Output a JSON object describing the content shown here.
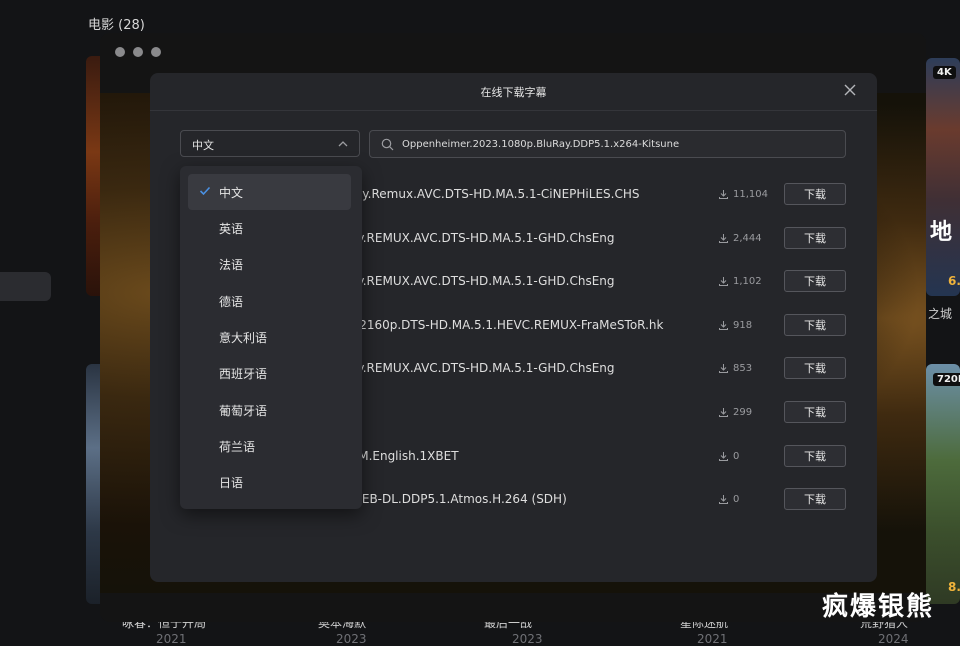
{
  "background": {
    "section_title": "电影 (28)",
    "badges": [
      "4K",
      "720P"
    ],
    "poster_text": "地",
    "ratings": [
      "6.",
      "8."
    ],
    "captions": [
      {
        "title": "咏春：恒于开局",
        "year": "2021"
      },
      {
        "title": "奥本海默",
        "year": "2023"
      },
      {
        "title": "最后一战",
        "year": "2023"
      },
      {
        "title": "星际迷航",
        "year": "2021"
      },
      {
        "title": "荒野猎人",
        "year": "2024"
      }
    ],
    "right_caption": "之城",
    "watermark": "疯爆银熊"
  },
  "modal": {
    "title": "在线下载字幕",
    "language_select": {
      "value": "中文"
    },
    "search": {
      "value": "Oppenheimer.2023.1080p.BluRay.DDP5.1.x264-Kitsune"
    },
    "download_label": "下载",
    "results": [
      {
        "name": "ray.Remux.AVC.DTS-HD.MA.5.1-CiNEPHiLES.CHS",
        "downloads": "11,104"
      },
      {
        "name": "ay.REMUX.AVC.DTS-HD.MA.5.1-GHD.ChsEng",
        "downloads": "2,444"
      },
      {
        "name": "ay.REMUX.AVC.DTS-HD.MA.5.1-GHD.ChsEng",
        "downloads": "1,102"
      },
      {
        "name": "y.2160p.DTS-HD.MA.5.1.HEVC.REMUX-FraMeSToR.hk",
        "downloads": "918"
      },
      {
        "name": "ay.REMUX.AVC.DTS-HD.MA.5.1-GHD.ChsEng",
        "downloads": "853"
      },
      {
        "name": "",
        "downloads": "299"
      },
      {
        "name": "AM.English.1XBET",
        "downloads": "0"
      },
      {
        "name": "WEB-DL.DDP5.1.Atmos.H.264 (SDH)",
        "downloads": "0"
      }
    ],
    "language_options": [
      {
        "label": "中文",
        "selected": true
      },
      {
        "label": "英语",
        "selected": false
      },
      {
        "label": "法语",
        "selected": false
      },
      {
        "label": "德语",
        "selected": false
      },
      {
        "label": "意大利语",
        "selected": false
      },
      {
        "label": "西班牙语",
        "selected": false
      },
      {
        "label": "葡萄牙语",
        "selected": false
      },
      {
        "label": "荷兰语",
        "selected": false
      },
      {
        "label": "日语",
        "selected": false
      }
    ]
  },
  "colors": {
    "accent": "#4a90e2",
    "modal_bg": "#25262a"
  }
}
